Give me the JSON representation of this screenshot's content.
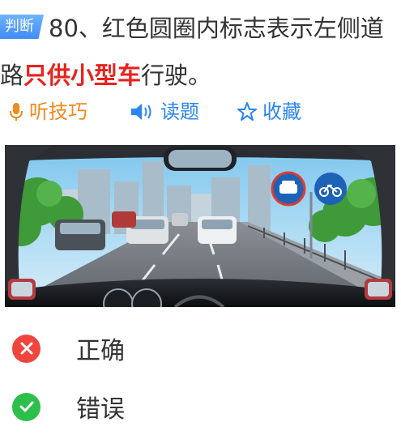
{
  "question": {
    "badge": "判断",
    "text_before": "80、红色圆圈内标志表示左侧道路",
    "highlight": "只供小型车",
    "text_after": "行驶。"
  },
  "toolbar": {
    "listen_label": "听技巧",
    "read_label": "读题",
    "fav_label": "收藏"
  },
  "options": [
    {
      "label": "正确",
      "icon": "x-circle-icon",
      "color": "#f0443f"
    },
    {
      "label": "错误",
      "icon": "check-circle-icon",
      "color": "#2cbf49"
    }
  ],
  "colors": {
    "accent_blue": "#2a86f0",
    "highlight_red": "#e8221e",
    "listen_orange": "#f08a1c"
  }
}
